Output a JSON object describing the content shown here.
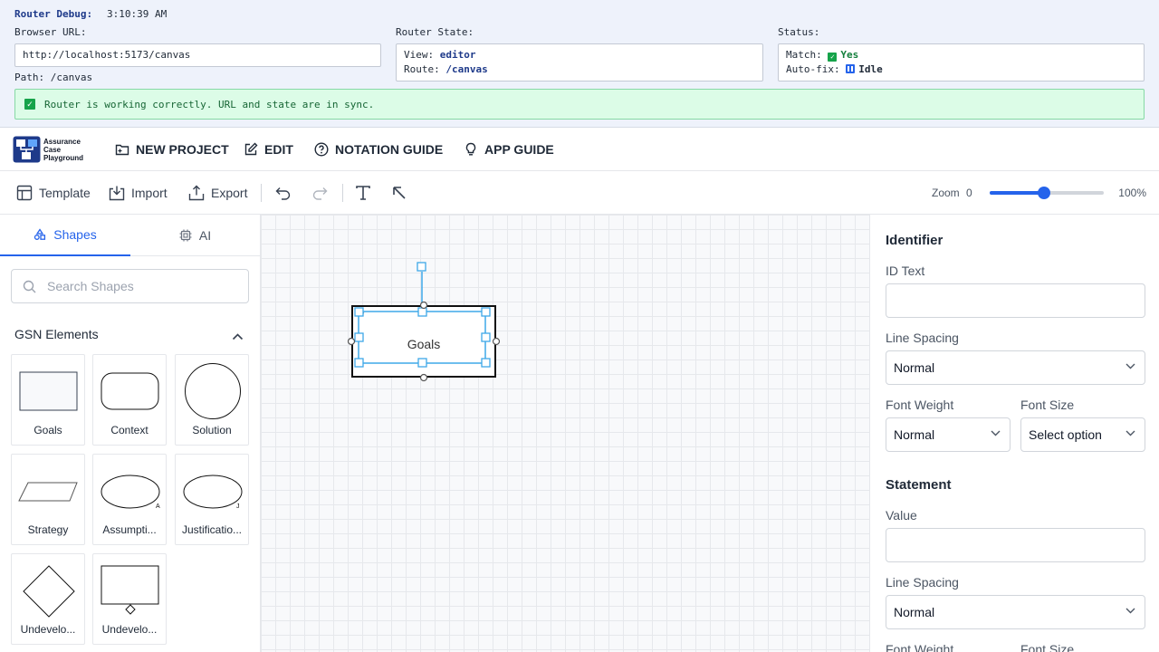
{
  "debug": {
    "title": "Router Debug:",
    "time": "3:10:39 AM",
    "browser_url_label": "Browser URL:",
    "browser_url": "http://localhost:5173/canvas",
    "path": "Path: /canvas",
    "router_state_label": "Router State:",
    "view_label": "View:",
    "view_value": "editor",
    "route_label": "Route:",
    "route_value": "/canvas",
    "status_label": "Status:",
    "match_label": "Match:",
    "match_value": "Yes",
    "autofix_label": "Auto-fix:",
    "autofix_value": "Idle",
    "banner": "Router is working correctly. URL and state are in sync."
  },
  "nav": {
    "logo_text": [
      "Assurance",
      "Case",
      "Playground"
    ],
    "items": [
      {
        "label": "NEW PROJECT",
        "icon": "folder-plus-icon"
      },
      {
        "label": "EDIT",
        "icon": "edit-icon"
      },
      {
        "label": "NOTATION GUIDE",
        "icon": "help-circle-icon"
      },
      {
        "label": "APP GUIDE",
        "icon": "lightbulb-icon"
      }
    ]
  },
  "toolbar": {
    "template": "Template",
    "import": "Import",
    "export": "Export",
    "zoom_label": "Zoom",
    "zoom_min": "0",
    "zoom_value": "100%",
    "zoom_fraction": 0.48
  },
  "left": {
    "tabs": [
      {
        "label": "Shapes"
      },
      {
        "label": "AI"
      }
    ],
    "search_placeholder": "Search Shapes",
    "section_title": "GSN Elements",
    "shapes": [
      "Goals",
      "Context",
      "Solution",
      "Strategy",
      "Assumpti...",
      "Justificatio...",
      "Undevelo...",
      "Undevelo..."
    ]
  },
  "canvas": {
    "node_label": "Goals"
  },
  "right": {
    "identifier_title": "Identifier",
    "id_text_label": "ID Text",
    "line_spacing_label": "Line Spacing",
    "line_spacing_value": "Normal",
    "font_weight_label": "Font Weight",
    "font_weight_value": "Normal",
    "font_size_label": "Font Size",
    "font_size_value": "Select option",
    "statement_title": "Statement",
    "value_label": "Value",
    "line_spacing_label_2": "Line Spacing",
    "line_spacing_value_2": "Normal",
    "font_weight_label_2": "Font Weight",
    "font_size_label_2": "Font Size"
  },
  "colors": {
    "accent": "#2563eb",
    "success": "#16a34a",
    "banner_bg": "#dcfce7",
    "selection": "#3ea8e8"
  }
}
